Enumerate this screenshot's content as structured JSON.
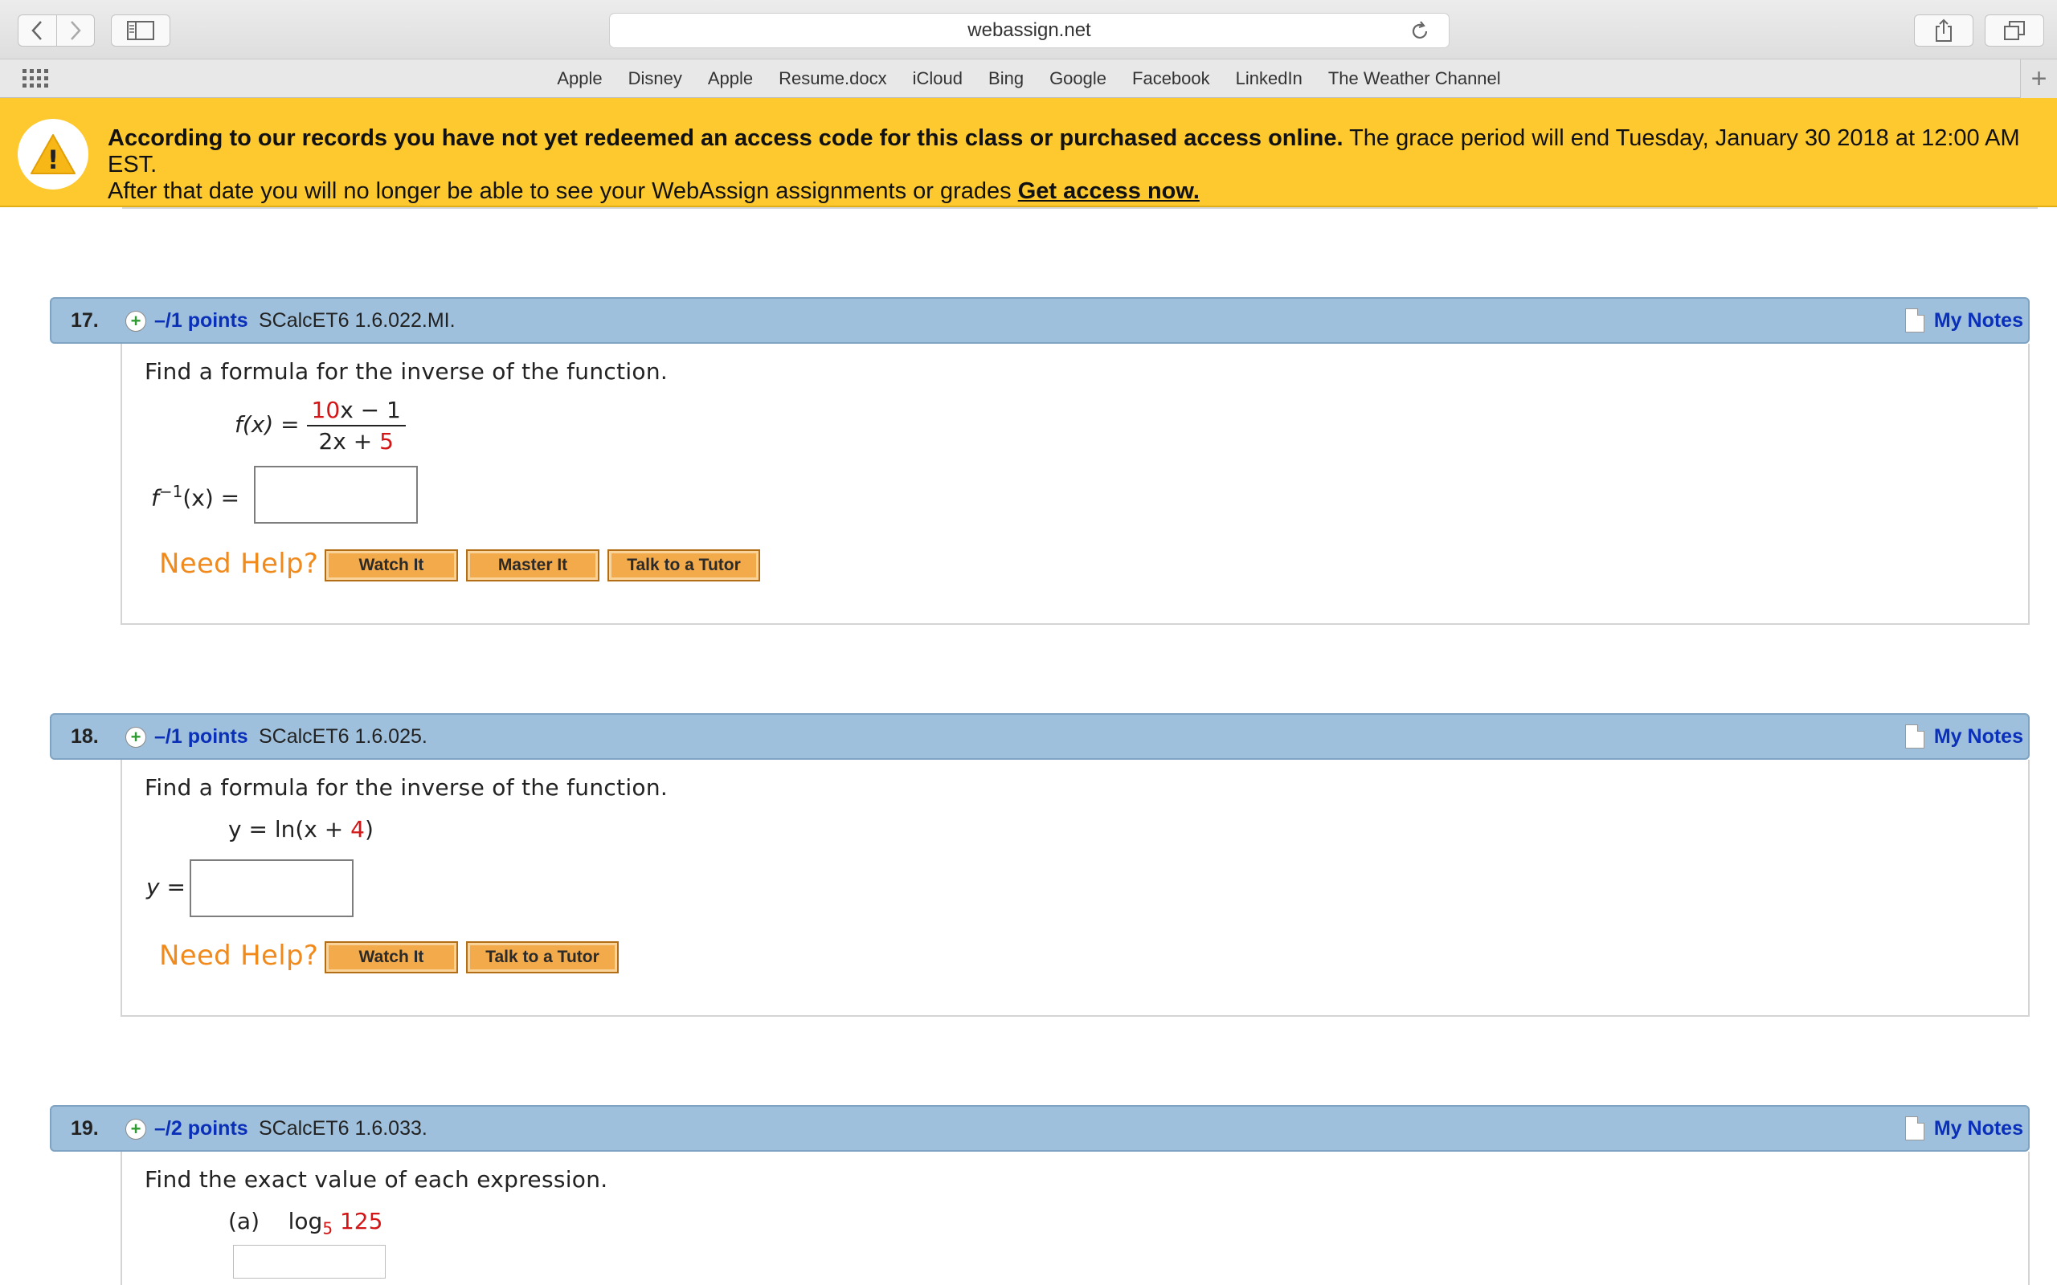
{
  "browser": {
    "url": "webassign.net",
    "bookmarks": [
      "Apple",
      "Disney",
      "Apple",
      "Resume.docx",
      "iCloud",
      "Bing",
      "Google",
      "Facebook",
      "LinkedIn",
      "The Weather Channel"
    ],
    "new_tab_label": "+"
  },
  "banner": {
    "bold_text": "According to our records you have not yet redeemed an access code for this class or purchased access online.",
    "text_1": " The grace period will end Tuesday, January 30 2018 at 12:00 AM EST.",
    "text_2": "After that date you will no longer be able to see your WebAssign assignments or grades ",
    "link": "Get access now.",
    "warn_symbol": "!"
  },
  "common": {
    "my_notes": "My Notes",
    "need_help": "Need Help?",
    "watch_it": "Watch It",
    "master_it": "Master It",
    "talk_tutor": "Talk to a Tutor",
    "plus": "+"
  },
  "questions": [
    {
      "number": "17.",
      "points": "–/1 points",
      "source": "SCalcET6 1.6.022.MI.",
      "prompt": "Find a formula for the inverse of the function.",
      "fx_label": "f(x) =",
      "num_coef": "10",
      "num_rest": "x − 1",
      "den_left": "2x + ",
      "den_red": "5",
      "answer_label": "f",
      "answer_sup": "−1",
      "answer_tail": "(x) ="
    },
    {
      "number": "18.",
      "points": "–/1 points",
      "source": "SCalcET6 1.6.025.",
      "prompt": "Find a formula for the inverse of the function.",
      "eq_left": "y = ln(x + ",
      "eq_red": "4",
      "eq_right": ")",
      "answer_label": "y ="
    },
    {
      "number": "19.",
      "points": "–/2 points",
      "source": "SCalcET6 1.6.033.",
      "prompt": "Find the exact value of each expression.",
      "part_label": "(a)",
      "log_text": "log",
      "log_base": "5",
      "log_arg": "125"
    }
  ]
}
